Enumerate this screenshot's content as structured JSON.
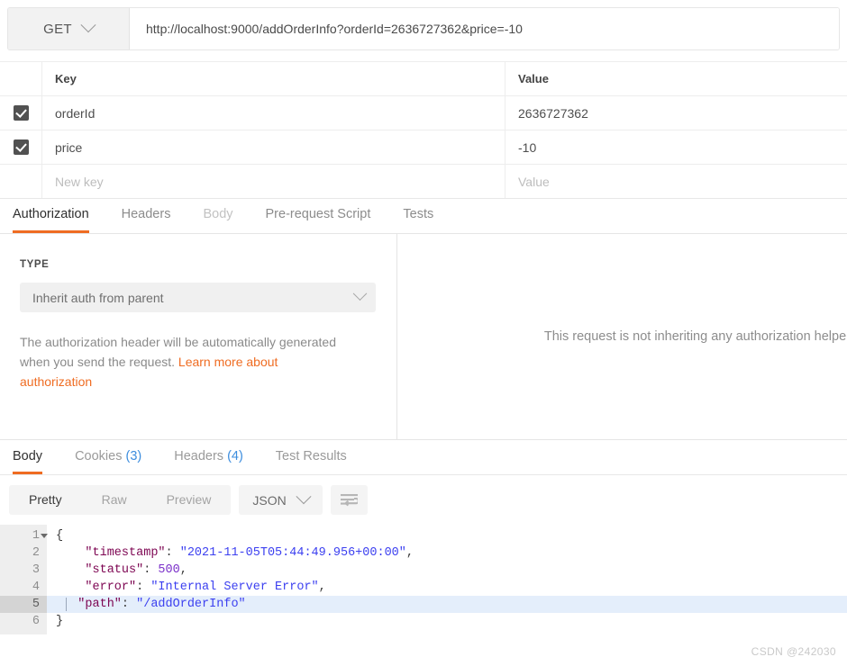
{
  "request": {
    "method": "GET",
    "url": "http://localhost:9000/addOrderInfo?orderId=2636727362&price=-10"
  },
  "params": {
    "headers": {
      "key": "Key",
      "value": "Value"
    },
    "rows": [
      {
        "key": "orderId",
        "value": "2636727362",
        "checked": true
      },
      {
        "key": "price",
        "value": "-10",
        "checked": true
      }
    ],
    "new_row": {
      "key_placeholder": "New key",
      "value_placeholder": "Value"
    }
  },
  "request_tabs": [
    {
      "label": "Authorization",
      "active": true,
      "dim": false
    },
    {
      "label": "Headers",
      "active": false,
      "dim": false
    },
    {
      "label": "Body",
      "active": false,
      "dim": true
    },
    {
      "label": "Pre-request Script",
      "active": false,
      "dim": false
    },
    {
      "label": "Tests",
      "active": false,
      "dim": false
    }
  ],
  "authorization": {
    "type_label": "TYPE",
    "selected_type": "Inherit auth from parent",
    "description_text": "The authorization header will be automatically generated when you send the request. ",
    "link_text": "Learn more about authorization",
    "helper_message": "This request is not inheriting any authorization helper"
  },
  "response_tabs": [
    {
      "label": "Body",
      "count": "",
      "active": true
    },
    {
      "label": "Cookies",
      "count": "(3)",
      "active": false
    },
    {
      "label": "Headers",
      "count": "(4)",
      "active": false
    },
    {
      "label": "Test Results",
      "count": "",
      "active": false
    }
  ],
  "body_toolbar": {
    "view_modes": [
      {
        "label": "Pretty",
        "active": true
      },
      {
        "label": "Raw",
        "active": false
      },
      {
        "label": "Preview",
        "active": false
      }
    ],
    "format": "JSON",
    "wrap_icon": "word-wrap-icon"
  },
  "response_body": {
    "language": "json",
    "active_line": 5,
    "lines": [
      {
        "n": "1",
        "fold": true,
        "tokens": [
          {
            "t": "{",
            "c": "p"
          }
        ]
      },
      {
        "n": "2",
        "fold": false,
        "tokens": [
          {
            "t": "    \"timestamp\"",
            "c": "k"
          },
          {
            "t": ": ",
            "c": "p"
          },
          {
            "t": "\"2021-11-05T05:44:49.956+00:00\"",
            "c": "s"
          },
          {
            "t": ",",
            "c": "p"
          }
        ]
      },
      {
        "n": "3",
        "fold": false,
        "tokens": [
          {
            "t": "    \"status\"",
            "c": "k"
          },
          {
            "t": ": ",
            "c": "p"
          },
          {
            "t": "500",
            "c": "n"
          },
          {
            "t": ",",
            "c": "p"
          }
        ]
      },
      {
        "n": "4",
        "fold": false,
        "tokens": [
          {
            "t": "    \"error\"",
            "c": "k"
          },
          {
            "t": ": ",
            "c": "p"
          },
          {
            "t": "\"Internal Server Error\"",
            "c": "s"
          },
          {
            "t": ",",
            "c": "p"
          }
        ]
      },
      {
        "n": "5",
        "fold": false,
        "tokens": [
          {
            "t": "   \"path\"",
            "c": "k"
          },
          {
            "t": ": ",
            "c": "p"
          },
          {
            "t": "\"/addOrderInfo\"",
            "c": "s"
          }
        ]
      },
      {
        "n": "6",
        "fold": false,
        "tokens": [
          {
            "t": "}",
            "c": "p"
          }
        ]
      }
    ]
  },
  "watermark": "CSDN @242030",
  "colors": {
    "accent": "#ef6c22",
    "count_blue": "#3c8dde",
    "json_key": "#7d0552",
    "json_string": "#3c40f0",
    "json_number": "#7a2fc9"
  }
}
